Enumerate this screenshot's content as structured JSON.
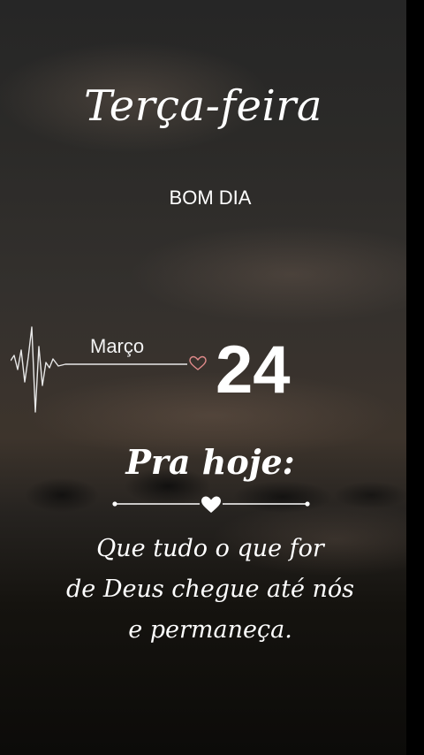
{
  "card": {
    "weekday": "Terça-feira",
    "greeting": "BOM DIA",
    "month": "Março",
    "day": "24",
    "heading": "Pra hoje:",
    "message": [
      "Que tudo o que for",
      "de Deus chegue até nós",
      "e permaneça."
    ]
  },
  "icons": {
    "pulse": "heartbeat-line-icon",
    "pulse_end": "heart-outline-icon",
    "divider": "heart-divider-icon"
  },
  "colors": {
    "text": "#ffffff",
    "heart_outline": "#e08a8a"
  }
}
